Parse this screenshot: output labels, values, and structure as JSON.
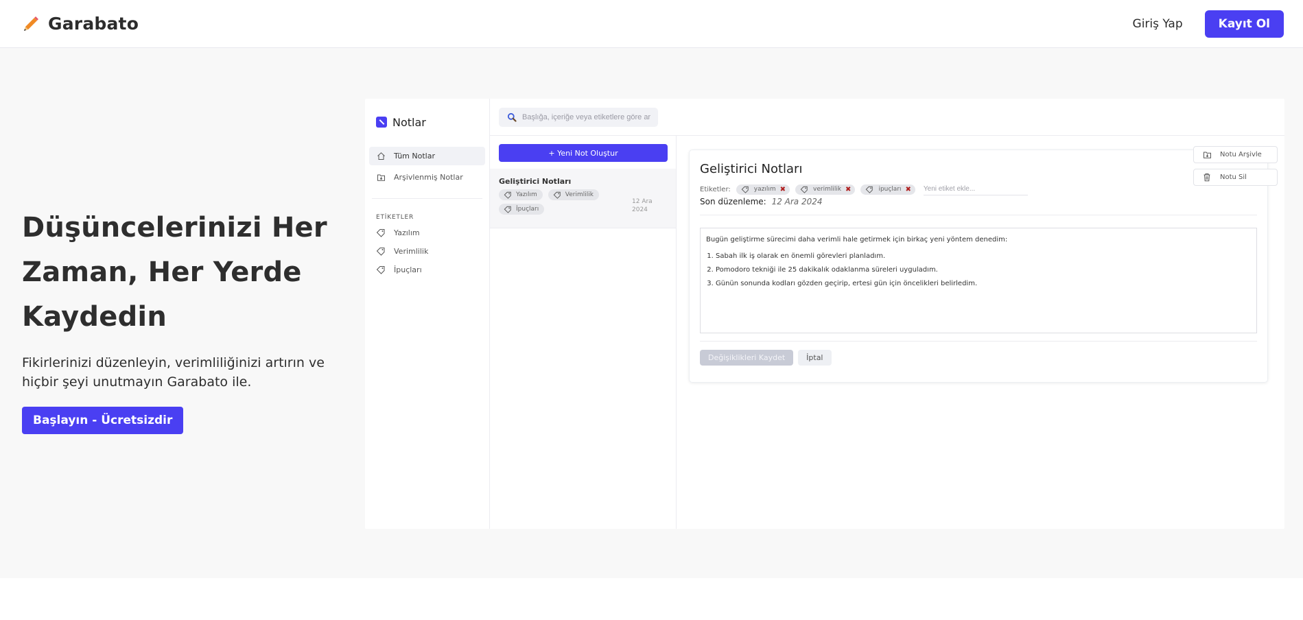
{
  "nav": {
    "brand": "Garabato",
    "brand_icon": "pencil-icon",
    "login": "Giriş Yap",
    "signup": "Kayıt Ol"
  },
  "hero": {
    "title_line1": "Düşüncelerinizi Her",
    "title_line2": "Zaman, Her Yerde",
    "title_line3": "Kaydedin",
    "subtitle": "Fikirlerinizi düzenleyin, verimliliğinizi artırın ve hiçbir şeyi unutmayın Garabato ile.",
    "cta": "Başlayın - Ücretsizdir"
  },
  "app": {
    "sidebar": {
      "title": "Notlar",
      "items": [
        {
          "label": "Tüm Notlar",
          "icon": "home-icon"
        },
        {
          "label": "Arşivlenmiş Notlar",
          "icon": "archive-icon"
        }
      ],
      "tags_heading": "ETİKETLER",
      "tags": [
        {
          "label": "Yazılım",
          "icon": "tag-icon"
        },
        {
          "label": "Verimlilik",
          "icon": "tag-icon"
        },
        {
          "label": "İpuçları",
          "icon": "tag-icon"
        }
      ]
    },
    "search": {
      "placeholder": "Başlığa, içeriğe veya etiketlere göre ar"
    },
    "notelist": {
      "new_note": "+ Yeni Not Oluştur",
      "notes": [
        {
          "title": "Geliştirici Notları",
          "tags": [
            "Yazılım",
            "Verimlilik",
            "İpuçları"
          ],
          "date_line1": "12 Ara",
          "date_line2": "2024"
        }
      ]
    },
    "editor": {
      "title": "Geliştirici Notları",
      "tags_label": "Etiketler:",
      "tags": [
        "yazılım",
        "verimlilik",
        "ipuçları"
      ],
      "tag_input_placeholder": "Yeni etiket ekle...",
      "edited_label": "Son düzenleme:",
      "edited_value": "12 Ara 2024",
      "body_intro": "Bugün geliştirme sürecimi daha verimli hale getirmek için birkaç yeni yöntem denedim:",
      "body_items": [
        "Sabah ilk iş olarak en önemli görevleri planladım.",
        "Pomodoro tekniği ile 25 dakikalık odaklanma süreleri uyguladım.",
        "Günün sonunda kodları gözden geçirip, ertesi gün için öncelikleri belirledim."
      ],
      "save": "Değişiklikleri Kaydet",
      "cancel": "İptal",
      "archive": "Notu Arşivle",
      "delete": "Notu Sil"
    }
  },
  "colors": {
    "accent": "#4a3ff2",
    "hero_bg": "#f8f8f8",
    "tag_remove": "#b02020"
  }
}
